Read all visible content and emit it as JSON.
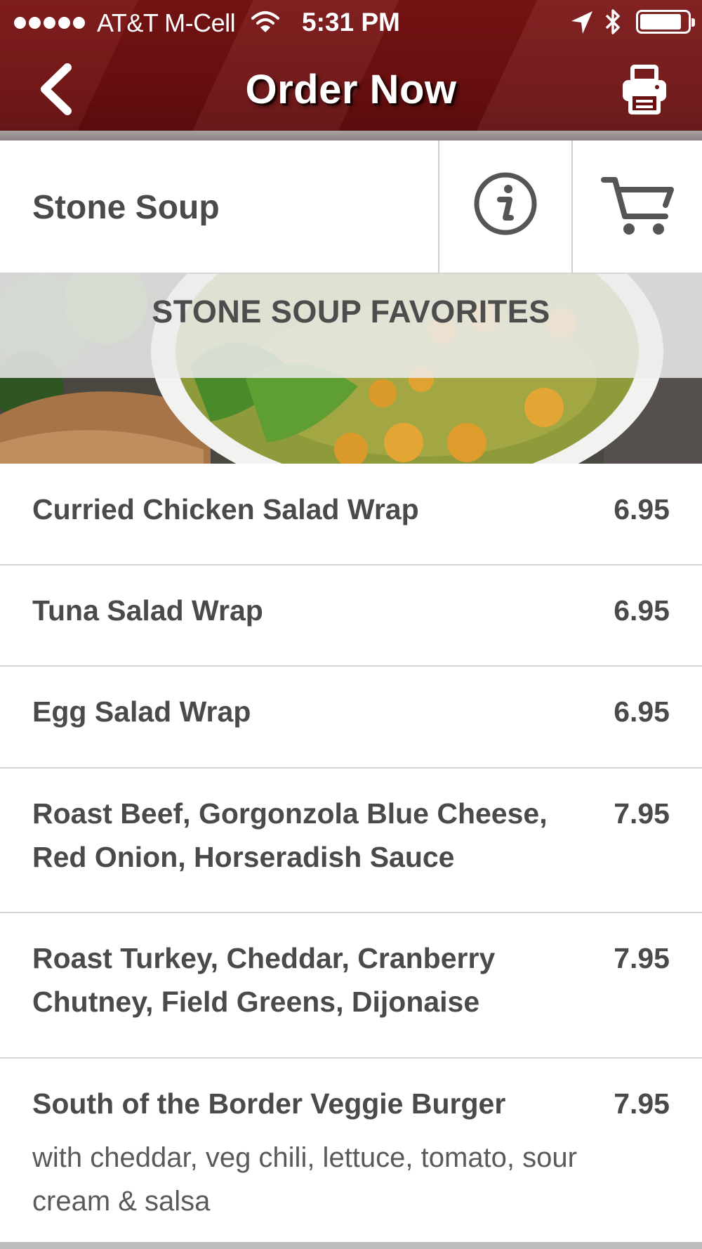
{
  "status_bar": {
    "carrier": "AT&T M-Cell",
    "time": "5:31 PM"
  },
  "nav": {
    "title": "Order Now",
    "back_icon": "chevron-left-icon",
    "print_icon": "printer-icon"
  },
  "restaurant": {
    "name": "Stone Soup",
    "info_icon": "info-icon",
    "cart_icon": "cart-icon"
  },
  "category": {
    "title": "STONE SOUP FAVORITES"
  },
  "menu": {
    "items": [
      {
        "name": "Curried Chicken Salad Wrap",
        "price": "6.95"
      },
      {
        "name": "Tuna Salad Wrap",
        "price": "6.95"
      },
      {
        "name": "Egg Salad Wrap",
        "price": "6.95"
      },
      {
        "name": "Roast Beef, Gorgonzola Blue Cheese, Red Onion, Horseradish Sauce",
        "price": "7.95"
      },
      {
        "name": "Roast Turkey, Cheddar, Cranberry Chutney, Field Greens, Dijonaise",
        "price": "7.95"
      },
      {
        "name": "South of the Border Veggie Burger",
        "price": "7.95",
        "description": "with cheddar, veg chili, lettuce, tomato, sour cream & salsa"
      }
    ]
  },
  "colors": {
    "header_red": "#6c0f10",
    "text_gray": "#4a4a4a",
    "divider": "#d6d6d6"
  }
}
